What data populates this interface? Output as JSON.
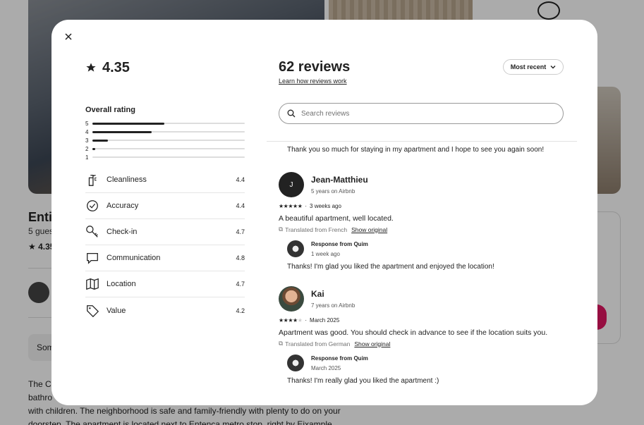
{
  "background": {
    "title": "Enti",
    "guests": "5 gues",
    "rating": "★ 4.35",
    "pill": "Som",
    "description": "The C\nbathro\nwith children. The neighborhood is safe and family-friendly with plenty to do on your\ndoorstep. The apartment is located next to Entença metro stop, right by Eixample"
  },
  "summary": {
    "rating": "4.35",
    "overall_label": "Overall rating",
    "distribution": [
      {
        "stars": "5",
        "fraction": 0.47
      },
      {
        "stars": "4",
        "fraction": 0.39
      },
      {
        "stars": "3",
        "fraction": 0.1
      },
      {
        "stars": "2",
        "fraction": 0.02
      },
      {
        "stars": "1",
        "fraction": 0.0
      }
    ],
    "categories": [
      {
        "icon": "spray-bottle-icon",
        "label": "Cleanliness",
        "value": "4.4"
      },
      {
        "icon": "check-circle-icon",
        "label": "Accuracy",
        "value": "4.4"
      },
      {
        "icon": "key-icon",
        "label": "Check-in",
        "value": "4.7"
      },
      {
        "icon": "chat-bubble-icon",
        "label": "Communication",
        "value": "4.8"
      },
      {
        "icon": "map-icon",
        "label": "Location",
        "value": "4.7"
      },
      {
        "icon": "tag-icon",
        "label": "Value",
        "value": "4.2"
      }
    ]
  },
  "reviews_panel": {
    "title": "62 reviews",
    "learn_link": "Learn how reviews work",
    "sort_label": "Most recent",
    "search_placeholder": "Search reviews",
    "previous_response_text": "Thank you so much for staying in my apartment and I hope to see you again soon!",
    "reviews": [
      {
        "initial": "J",
        "name": "Jean-Matthieu",
        "since": "5 years on Airbnb",
        "stars": 5,
        "date": "3 weeks ago",
        "body": "A beautiful apartment, well located.",
        "translated": "Translated from French",
        "show_original": "Show original",
        "response_title": "Response from Quim",
        "response_date": "1 week ago",
        "response_body": "Thanks! I'm glad you liked the apartment and enjoyed the location!"
      },
      {
        "initial": "",
        "name": "Kai",
        "since": "7 years on Airbnb",
        "stars": 4,
        "date": "March 2025",
        "body": "Apartment was good. You should check in advance to see if the location suits you.",
        "translated": "Translated from German",
        "show_original": "Show original",
        "response_title": "Response from Quim",
        "response_date": "March 2025",
        "response_body": "Thanks! I'm really glad you liked the apartment :)"
      }
    ]
  }
}
